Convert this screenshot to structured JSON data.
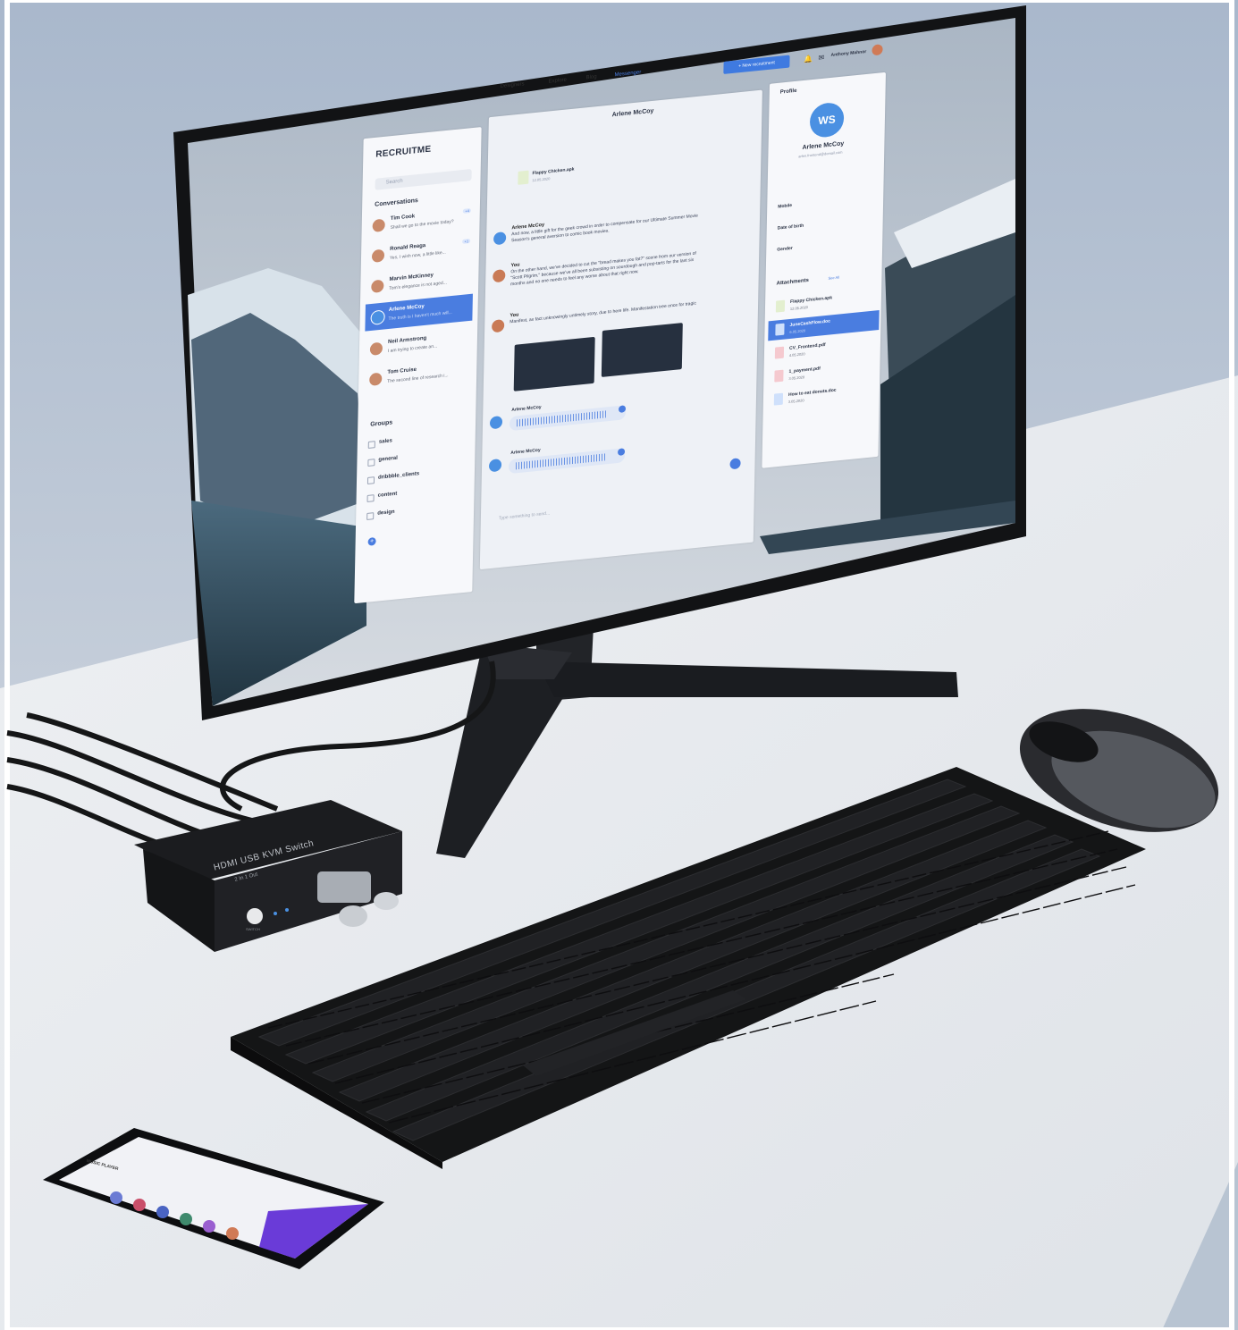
{
  "app": {
    "brand": "RECRUITME",
    "search_placeholder": "Search",
    "nav": [
      "Designers",
      "Explore",
      "Blog",
      "Messenger"
    ],
    "new_button": "+ New recruitment",
    "user_name": "Anthony Mahnor"
  },
  "conversations": {
    "title": "Conversations",
    "items": [
      {
        "name": "Tim Cook",
        "preview": "Shall we go to the movie today?",
        "badge": "+4"
      },
      {
        "name": "Ronald Reaga",
        "preview": "Yes, I wish now, a little like...",
        "badge": "+1"
      },
      {
        "name": "Marvin McKinney",
        "preview": "Tom's elegance is not aged...",
        "badge": ""
      },
      {
        "name": "Arlene McCoy",
        "preview": "The truth is I haven't much will...",
        "badge": ""
      },
      {
        "name": "Neil Armstrong",
        "preview": "I am trying to create an...",
        "badge": ""
      },
      {
        "name": "Tom Cruise",
        "preview": "The second line of research i...",
        "badge": ""
      }
    ]
  },
  "groups": {
    "title": "Groups",
    "items": [
      "sales",
      "general",
      "dribbble_clients",
      "content",
      "design"
    ]
  },
  "chat": {
    "title": "Arlene McCoy",
    "file": {
      "name": "Flappy Chicken.apk",
      "date": "12.05.2020"
    },
    "messages": [
      {
        "who": "Arlene McCoy",
        "text": "And now, a little gift for the geek crowd in order to compensate for our Ultimate Summer Movie Season's general aversion to comic book movies."
      },
      {
        "who": "You",
        "text": "On the other hand, we've decided to cut the \"bread makes you fat?\" scene from our version of \"Scott Pilgrim,\" because we've all been subsisting on sourdough and pop-tarts for the last six months and no one needs to feel any worse about that right now."
      },
      {
        "who": "You",
        "text": "Manifest, as fact unknowingly untimely story, due to here life. Manifestation tree once for tragic"
      }
    ],
    "voice_sender": "Arlene McCoy",
    "input_placeholder": "Type something to send..."
  },
  "profile": {
    "title": "Profile",
    "initials": "WS",
    "name": "Arlene McCoy",
    "email": "arlen.frontend@domail.com",
    "fields": [
      "Mobile",
      "Date of birth",
      "Gender"
    ],
    "attachments_title": "Attachments",
    "see_all": "See All",
    "attachments": [
      {
        "name": "Flappy Chicken.apk",
        "date": "12.05.2020"
      },
      {
        "name": "JuneCashFlow.doc",
        "date": "6.05.2020"
      },
      {
        "name": "CV_Frontend.pdf",
        "date": "4.05.2020"
      },
      {
        "name": "1_payment.pdf",
        "date": "3.05.2020"
      },
      {
        "name": "How to eat donuts.doc",
        "date": "3.05.2020"
      }
    ]
  },
  "hardware": {
    "kvm_label": "HDMI USB KVM Switch",
    "kvm_sub": "2 In 1 Out",
    "switch_label": "SWITCH"
  },
  "phone": {
    "app_title": "MUSIC PLAYER"
  }
}
